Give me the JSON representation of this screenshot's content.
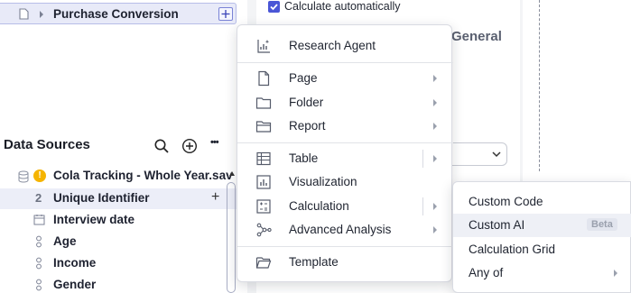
{
  "tree": {
    "item_label": "Purchase Conversion"
  },
  "data_sources": {
    "title": "Data Sources",
    "file": {
      "name": "Cola Tracking - Whole Year.sav",
      "warning_symbol": "!"
    },
    "variables": [
      {
        "label": "Unique Identifier",
        "type_glyph": "2"
      },
      {
        "label": "Interview date"
      },
      {
        "label": "Age"
      },
      {
        "label": "Income"
      },
      {
        "label": "Gender"
      }
    ],
    "add_symbol": "+",
    "more_symbol": "•••"
  },
  "settings": {
    "calculate_automatically": "Calculate automatically",
    "tab_general": "General"
  },
  "menu": {
    "items": [
      {
        "label": "Research Agent",
        "icon": "research-agent-icon"
      },
      {
        "label": "Page",
        "icon": "page-icon"
      },
      {
        "label": "Folder",
        "icon": "folder-icon"
      },
      {
        "label": "Report",
        "icon": "report-icon"
      },
      {
        "label": "Table",
        "icon": "table-icon"
      },
      {
        "label": "Visualization",
        "icon": "visualization-icon"
      },
      {
        "label": "Calculation",
        "icon": "calculation-icon"
      },
      {
        "label": "Advanced Analysis",
        "icon": "advanced-analysis-icon"
      },
      {
        "label": "Template",
        "icon": "template-icon"
      }
    ]
  },
  "submenu": {
    "items": [
      {
        "label": "Custom Code"
      },
      {
        "label": "Custom AI",
        "badge": "Beta"
      },
      {
        "label": "Calculation Grid"
      },
      {
        "label": "Any of"
      }
    ]
  },
  "colors": {
    "accent": "#4a56d6",
    "warning": "#f5b400",
    "selected_row": "#e8eaf8"
  }
}
